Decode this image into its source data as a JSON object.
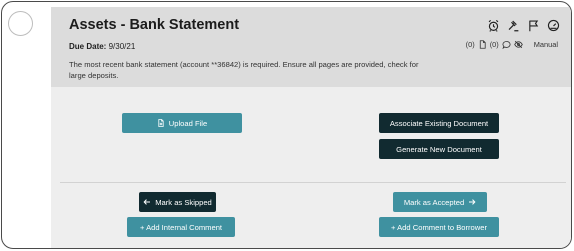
{
  "card": {
    "title": "Assets - Bank Statement",
    "due_label": "Due Date:",
    "due_value": "9/30/21",
    "description": "The most recent bank statement (account **36842) is required. Ensure all pages are provided, check for large deposits."
  },
  "header_icons": [
    "alarm-clock-icon",
    "gavel-icon",
    "flag-icon",
    "speedometer-icon"
  ],
  "meta": {
    "docs_count": "(0)",
    "comments_count": "(0)",
    "mode": "Manual"
  },
  "actions": {
    "upload": "Upload File",
    "associate": "Associate Existing Document",
    "generate": "Generate New Document",
    "skip": "Mark as Skipped",
    "accept": "Mark as Accepted",
    "internal_comment": "+ Add Internal Comment",
    "borrower_comment": "+ Add Comment to Borrower"
  },
  "colors": {
    "teal": "#3f91a0",
    "dark": "#112a30",
    "header_bg": "#dcdcdc",
    "card_bg": "#eeeeee"
  }
}
